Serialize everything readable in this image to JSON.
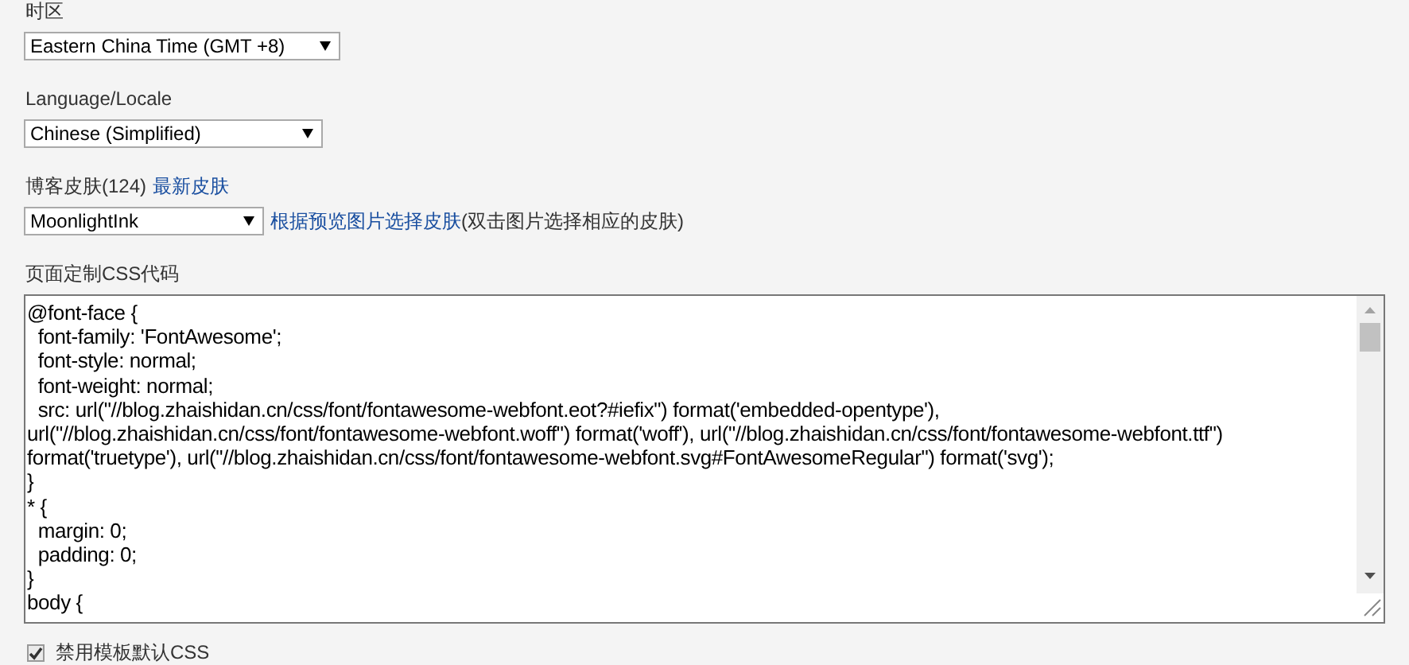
{
  "timezone": {
    "label": "时区",
    "value": "Eastern China Time (GMT +8)"
  },
  "locale": {
    "label": "Language/Locale",
    "value": "Chinese (Simplified)"
  },
  "skin": {
    "label": "博客皮肤(124)",
    "link": "最新皮肤",
    "value": "MoonlightInk",
    "hint_link": "根据预览图片选择皮肤",
    "hint": "(双击图片选择相应的皮肤)"
  },
  "custom_css": {
    "label": "页面定制CSS代码",
    "lines": [
      "@font-face {",
      "  font-family: 'FontAwesome';",
      "  font-style: normal;",
      "  font-weight: normal;",
      "  src: url(\"//blog.zhaishidan.cn/css/font/fontawesome-webfont.eot?#iefix\") format('embedded-opentype'),",
      "url(\"//blog.zhaishidan.cn/css/font/fontawesome-webfont.woff\") format('woff'), url(\"//blog.zhaishidan.cn/css/font/fontawesome-webfont.ttf\")",
      "format('truetype'), url(\"//blog.zhaishidan.cn/css/font/fontawesome-webfont.svg#FontAwesomeRegular\") format('svg');",
      "}",
      "* {",
      "  margin: 0;",
      "  padding: 0;",
      "}",
      "body {"
    ]
  },
  "disable_default_css": {
    "label": "禁用模板默认CSS",
    "checked": true
  }
}
